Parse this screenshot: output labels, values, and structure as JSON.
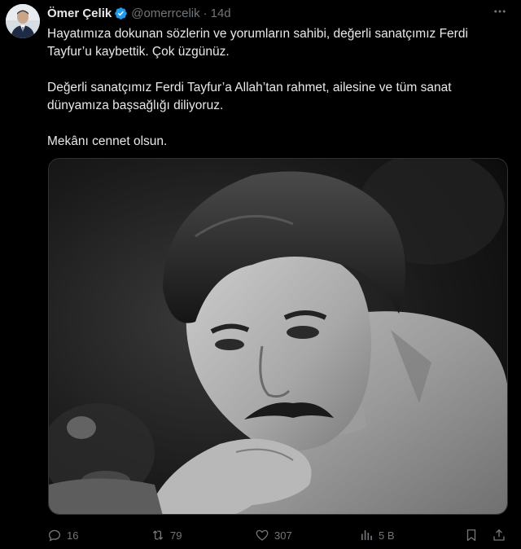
{
  "author": {
    "name": "Ömer Çelik",
    "handle": "@omerrcelik",
    "separator": "·",
    "time": "14d",
    "verified_color": "#1d9bf0"
  },
  "tweet": {
    "paragraphs": [
      "Hayatımıza dokunan sözlerin ve yorumların sahibi, değerli sanatçımız Ferdi Tayfur’u kaybettik. Çok üzgünüz.",
      "Değerli sanatçımız Ferdi Tayfur’a Allah’tan rahmet, ailesine ve tüm sanat dünyamıza başsağlığı diliyoruz.",
      "Mekânı cennet olsun."
    ]
  },
  "actions": {
    "reply_count": "16",
    "retweet_count": "79",
    "like_count": "307",
    "views_count": "5 B"
  },
  "icons": {
    "more": "more-icon",
    "reply": "reply-icon",
    "retweet": "retweet-icon",
    "like": "heart-icon",
    "views": "views-icon",
    "bookmark": "bookmark-icon",
    "share": "share-icon"
  },
  "colors": {
    "background": "#000000",
    "text": "#e7e9ea",
    "muted": "#71767b",
    "border": "#2f3336"
  }
}
